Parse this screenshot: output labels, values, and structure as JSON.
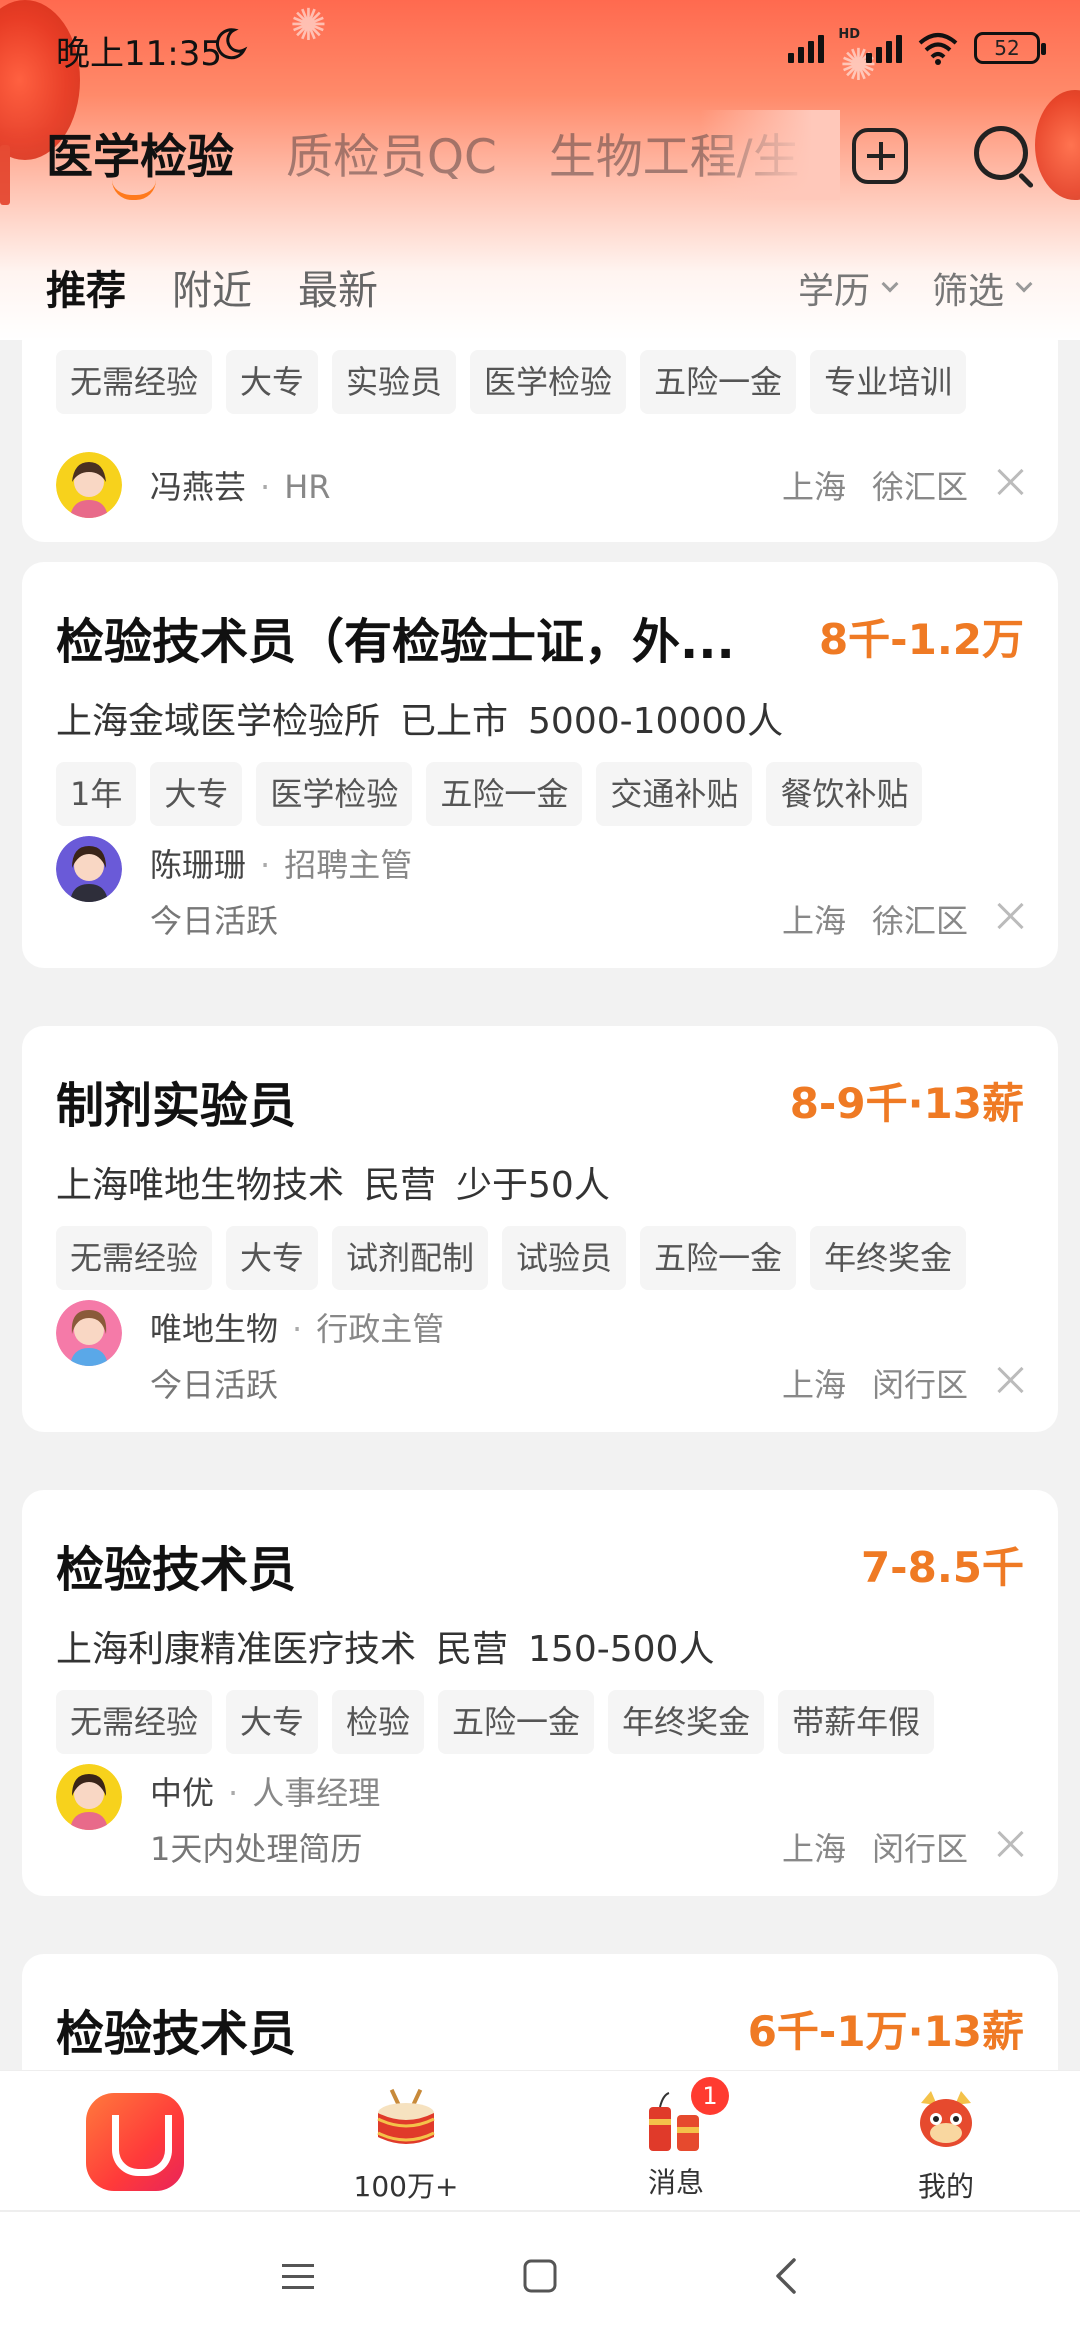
{
  "status_bar": {
    "time": "晚上11:35",
    "network_label": "HD",
    "battery": "52"
  },
  "category_tabs": [
    {
      "label": "医学检验",
      "active": true
    },
    {
      "label": "质检员QC",
      "active": false
    },
    {
      "label": "生物工程/生",
      "active": false
    }
  ],
  "icons": {
    "add": "plus-square-icon",
    "search": "search-icon",
    "moon": "moon-icon",
    "close": "close-icon"
  },
  "sub_tabs": [
    {
      "label": "推荐",
      "active": true
    },
    {
      "label": "附近",
      "active": false
    },
    {
      "label": "最新",
      "active": false
    }
  ],
  "filters": [
    {
      "label": "学历"
    },
    {
      "label": "筛选"
    }
  ],
  "jobs": [
    {
      "title": "",
      "salary": "",
      "company": [],
      "tags": [
        "无需经验",
        "大专",
        "实验员",
        "医学检验",
        "五险一金",
        "专业培训"
      ],
      "recruiter_name": "冯燕芸",
      "recruiter_role": "HR",
      "activity": "",
      "city": "上海",
      "district": "徐汇区"
    },
    {
      "title": "检验技术员（有检验士证，外...",
      "salary": "8千-1.2万",
      "company": [
        "上海金域医学检验所",
        "已上市",
        "5000-10000人"
      ],
      "tags": [
        "1年",
        "大专",
        "医学检验",
        "五险一金",
        "交通补贴",
        "餐饮补贴"
      ],
      "recruiter_name": "陈珊珊",
      "recruiter_role": "招聘主管",
      "activity": "今日活跃",
      "city": "上海",
      "district": "徐汇区"
    },
    {
      "title": "制剂实验员",
      "salary": "8-9千·13薪",
      "company": [
        "上海唯地生物技术",
        "民营",
        "少于50人"
      ],
      "tags": [
        "无需经验",
        "大专",
        "试剂配制",
        "试验员",
        "五险一金",
        "年终奖金"
      ],
      "recruiter_name": "唯地生物",
      "recruiter_role": "行政主管",
      "activity": "今日活跃",
      "city": "上海",
      "district": "闵行区"
    },
    {
      "title": "检验技术员",
      "salary": "7-8.5千",
      "company": [
        "上海利康精准医疗技术",
        "民营",
        "150-500人"
      ],
      "tags": [
        "无需经验",
        "大专",
        "检验",
        "五险一金",
        "年终奖金",
        "带薪年假"
      ],
      "recruiter_name": "中优",
      "recruiter_role": "人事经理",
      "activity": "1天内处理简历",
      "city": "上海",
      "district": "闵行区"
    },
    {
      "title": "检验技术员",
      "salary": "6千-1万·13薪",
      "company": [],
      "tags": [],
      "recruiter_name": "",
      "recruiter_role": "",
      "activity": "",
      "city": "",
      "district": ""
    }
  ],
  "bottom_nav": [
    {
      "label": "",
      "icon": "app-logo-icon"
    },
    {
      "label": "100万+",
      "icon": "drum-icon"
    },
    {
      "label": "消息",
      "icon": "firecracker-icon",
      "badge": "1"
    },
    {
      "label": "我的",
      "icon": "dragon-icon"
    }
  ],
  "colors": {
    "accent": "#ef7a24",
    "badge": "#ff3b30",
    "header_top": "#ff6a4f"
  }
}
